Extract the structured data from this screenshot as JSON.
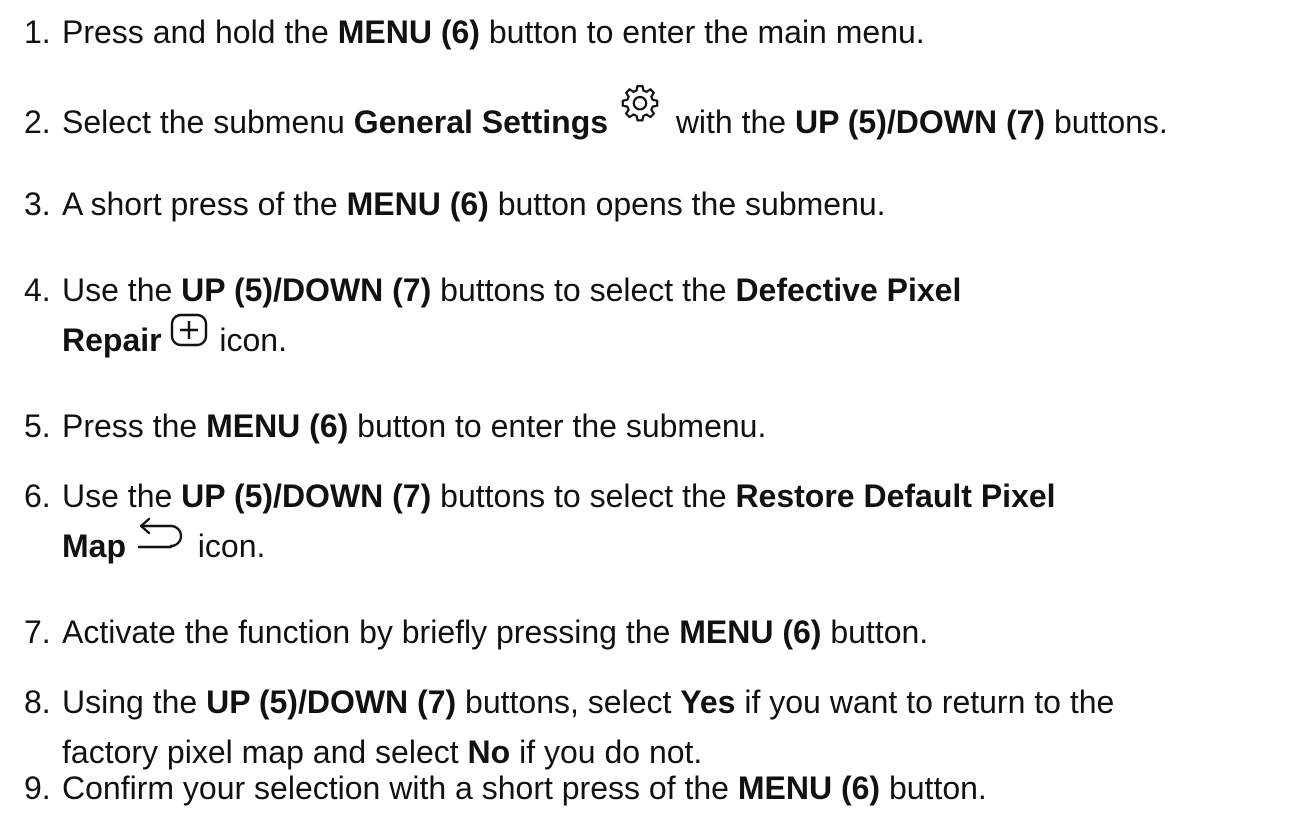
{
  "steps": [
    {
      "num": "1.",
      "parts": [
        "Press and hold the ",
        "MENU (6)",
        " button to enter the main menu."
      ]
    },
    {
      "num": "2.",
      "parts": [
        "Select the submenu ",
        "General Settings",
        " with the ",
        "UP (5)/DOWN (7)",
        " buttons."
      ],
      "icon": "gear-icon"
    },
    {
      "num": "3.",
      "parts": [
        "A short press of the ",
        "MENU (6)",
        " button opens the submenu."
      ]
    },
    {
      "num": "4.",
      "parts": [
        "Use the ",
        "UP (5)/DOWN (7)",
        " buttons to select the ",
        "Defective Pixel",
        "Repair",
        " icon."
      ],
      "icon": "plus-box-icon"
    },
    {
      "num": "5.",
      "parts": [
        "Press the ",
        "MENU (6)",
        " button to enter the submenu."
      ]
    },
    {
      "num": "6.",
      "parts": [
        "Use the ",
        "UP (5)/DOWN (7)",
        " buttons to select the ",
        "Restore Default Pixel",
        "Map",
        " icon."
      ],
      "icon": "return-arrow-icon"
    },
    {
      "num": "7.",
      "parts": [
        "Activate the function by briefly pressing the ",
        "MENU (6)",
        " button."
      ]
    },
    {
      "num": "8.",
      "parts": [
        "Using the ",
        "UP (5)/DOWN (7)",
        " buttons, select ",
        "Yes",
        " if you want to return to the",
        "factory pixel map and select ",
        "No",
        " if you do not."
      ]
    },
    {
      "num": "9.",
      "parts": [
        "Confirm your selection with a short press of the ",
        "MENU (6)",
        " button."
      ]
    }
  ]
}
